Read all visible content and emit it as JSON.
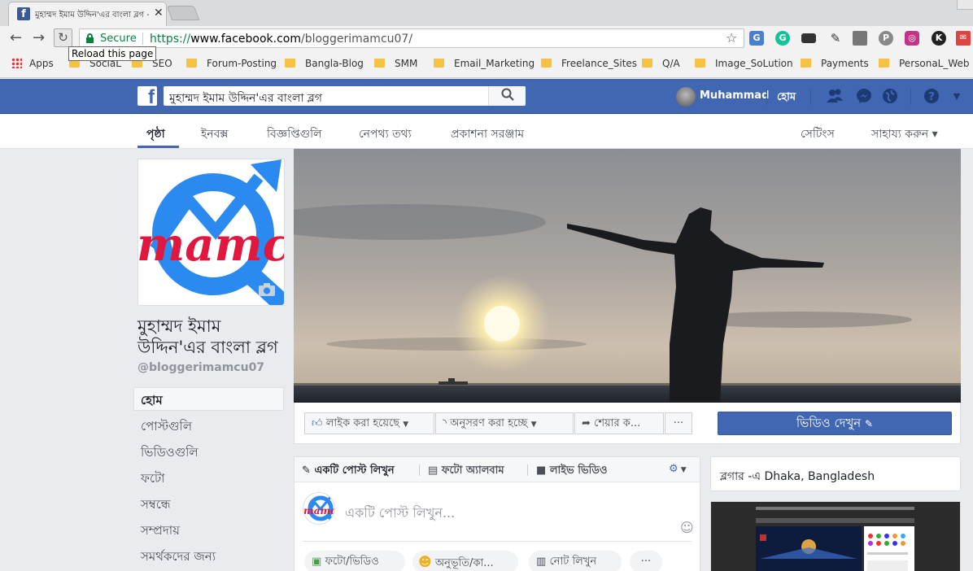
{
  "browser": {
    "tab_title": "মুহাম্মদ ইমাম উদ্দিন'এর বাংলা ব্লগ - হোম",
    "tooltip": "Reload this page",
    "secure_label": "Secure",
    "url_scheme": "https://",
    "url_host": "www.facebook.com",
    "url_path": "/bloggerimamcu07/",
    "ext_badge": "K"
  },
  "bookmarks": [
    "Apps",
    "SociaL",
    "SEO",
    "Forum-Posting",
    "Bangla-Blog",
    "SMM",
    "Email_Marketing",
    "Freelance_Sites",
    "Q/A",
    "Image_SoLution",
    "Payments",
    "PersonaL_Web"
  ],
  "fb": {
    "search_value": "মুহাম্মদ ইমাম উদ্দিন'এর বাংলা ব্লগ",
    "user_name": "Muhammad",
    "home_label": "হোম"
  },
  "page_nav": {
    "tabs": [
      "পৃষ্ঠা",
      "ইনবক্স",
      "বিজ্ঞপ্তিগুলি",
      "নেপথ্য তথ্য",
      "প্রকাশনা সরঞ্জাম"
    ],
    "settings": "সেটিংস",
    "help": "সাহায্য করুন ▾"
  },
  "profile": {
    "logo_text": "mamcu",
    "name": "মুহাম্মদ ইমাম উদ্দিন'এর বাংলা ব্লগ",
    "handle": "@bloggerimamcu07"
  },
  "left_nav": [
    "হোম",
    "পোস্টগুলি",
    "ভিডিওগুলি",
    "ফটো",
    "সম্বন্ধে",
    "সম্প্রদায়",
    "সমর্থকদের জন্য"
  ],
  "actions": {
    "liked": "লাইক করা হয়েছে",
    "following": "অনুসরণ করা হচ্ছে",
    "share": "শেয়ার ক...",
    "more": "···",
    "watch_video": "ভিডিও দেখুন"
  },
  "composer": {
    "tabs": [
      "একটি পোস্ট লিখুন",
      "ফটো অ্যালবাম",
      "লাইভ ভিডিও"
    ],
    "placeholder": "একটি পোস্ট লিখুন...",
    "buttons": [
      "ফটো/ভিডিও",
      "অনুভূতি/কা...",
      "নোট লিখুন",
      "···"
    ]
  },
  "blogger_card": "ব্লগার -এ Dhaka, Bangladesh",
  "colors": {
    "fb_blue": "#4267b2",
    "secure_green": "#0b8043",
    "bookmark_folder": "#f5c242"
  }
}
